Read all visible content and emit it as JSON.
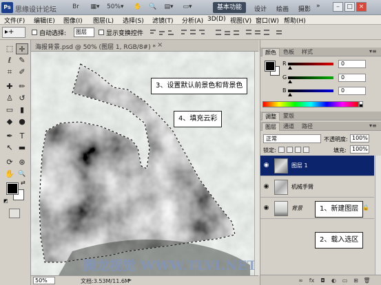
{
  "titlebar": {
    "app_logo": "Ps",
    "site_text": "思缘设计论坛",
    "workspace_active": "基本功能",
    "workspaces": [
      "设计",
      "绘画",
      "摄影"
    ],
    "more": "»",
    "icons": [
      "launch-bridge-icon",
      "view-extras-icon",
      "zoom-level-icon",
      "arrange-documents-icon",
      "screen-mode-icon"
    ],
    "window_buttons": [
      "–",
      "□",
      "×"
    ]
  },
  "menubar": {
    "items": [
      "文件(F)",
      "编辑(E)",
      "图像(I)",
      "图层(L)",
      "选择(S)",
      "滤镜(T)",
      "分析(A)",
      "3D(D)",
      "视图(V)",
      "窗口(W)",
      "帮助(H)"
    ]
  },
  "options": {
    "tool_preset": "▸+",
    "auto_select_label": "自动选择:",
    "auto_select_value": "图层",
    "show_transform_label": "显示变换控件",
    "auto_select_checked": false,
    "show_transform_checked": false
  },
  "tools": {
    "items": [
      {
        "name": "marquee-tool",
        "glyph": "⬚"
      },
      {
        "name": "move-tool",
        "glyph": "✛",
        "selected": true
      },
      {
        "name": "lasso-tool",
        "glyph": "ℓ"
      },
      {
        "name": "quick-select-tool",
        "glyph": "✎"
      },
      {
        "name": "crop-tool",
        "glyph": "⌗"
      },
      {
        "name": "eyedropper-tool",
        "glyph": "✐"
      },
      {
        "name": "healing-tool",
        "glyph": "✚"
      },
      {
        "name": "brush-tool",
        "glyph": "✏"
      },
      {
        "name": "clone-stamp-tool",
        "glyph": "♙"
      },
      {
        "name": "history-brush-tool",
        "glyph": "↺"
      },
      {
        "name": "eraser-tool",
        "glyph": "▭"
      },
      {
        "name": "gradient-tool",
        "glyph": "▮"
      },
      {
        "name": "blur-tool",
        "glyph": "◆"
      },
      {
        "name": "dodge-tool",
        "glyph": "●"
      },
      {
        "name": "pen-tool",
        "glyph": "✒"
      },
      {
        "name": "type-tool",
        "glyph": "T"
      },
      {
        "name": "path-select-tool",
        "glyph": "↖"
      },
      {
        "name": "shape-tool",
        "glyph": "▬"
      },
      {
        "name": "3d-rotate-tool",
        "glyph": "⟳"
      },
      {
        "name": "3d-orbit-tool",
        "glyph": "⊛"
      },
      {
        "name": "hand-tool",
        "glyph": "✋"
      },
      {
        "name": "zoom-tool",
        "glyph": "🔍"
      }
    ]
  },
  "document": {
    "tab_label": "海报背景.psd @ 50% (图层 1, RGB/8#) *",
    "close": "×",
    "zoom": "50%",
    "doc_size": "文档:3.53M/11.6M",
    "status_arrow": "▸",
    "watermark": "腾龙视觉 WWW.TLVI.NET"
  },
  "callouts": {
    "step3": "3、设置默认前景色和背景色",
    "step4": "4、填充云彩",
    "step1": "1、新建图层",
    "step2": "2、载入选区"
  },
  "color_panel": {
    "tabs": [
      "颜色",
      "色板",
      "样式"
    ],
    "menu": "▾≡",
    "channels": [
      {
        "label": "R",
        "value": "0",
        "color": "#e00000"
      },
      {
        "label": "G",
        "value": "0",
        "color": "#00b000"
      },
      {
        "label": "B",
        "value": "0",
        "color": "#0000e0"
      }
    ],
    "foreground": "#000000",
    "background": "#ffffff"
  },
  "adjust_panel": {
    "tabs": [
      "调整",
      "蒙版"
    ]
  },
  "layers_panel": {
    "tabs": [
      "图层",
      "通道",
      "路径"
    ],
    "blend_mode": "正常",
    "opacity_label": "不透明度:",
    "opacity": "100%",
    "lock_label": "锁定:",
    "fill_label": "填充:",
    "fill": "100%",
    "layers": [
      {
        "name": "图层 1",
        "selected": true,
        "visible": true
      },
      {
        "name": "机械手臂",
        "selected": false,
        "visible": true
      },
      {
        "name": "背景",
        "selected": false,
        "visible": true
      }
    ],
    "footer_icons": [
      "link-layers-icon",
      "fx-icon",
      "add-mask-icon",
      "adjustment-layer-icon",
      "group-icon",
      "new-layer-icon",
      "trash-icon"
    ]
  }
}
